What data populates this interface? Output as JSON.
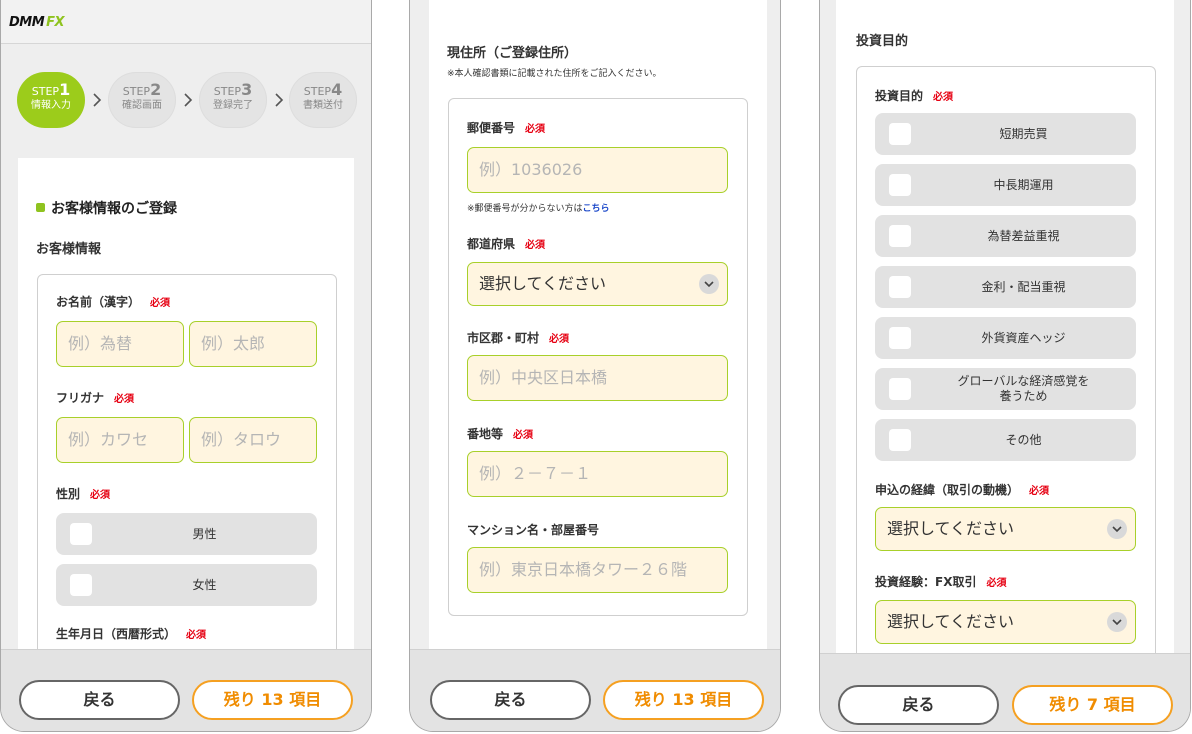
{
  "logo": {
    "dmm": "DMM",
    "fx": "FX"
  },
  "steps": [
    {
      "label": "STEP",
      "num": "1",
      "sub": "情報入力",
      "active": true
    },
    {
      "label": "STEP",
      "num": "2",
      "sub": "確認画面",
      "active": false
    },
    {
      "label": "STEP",
      "num": "3",
      "sub": "登録完了",
      "active": false
    },
    {
      "label": "STEP",
      "num": "4",
      "sub": "書類送付",
      "active": false
    }
  ],
  "screen1": {
    "section_title": "お客様情報のご登録",
    "sub_title": "お客様情報",
    "name_label": "お名前（漢字）",
    "last_name_placeholder": "例）為替",
    "first_name_placeholder": "例）太郎",
    "kana_label": "フリガナ",
    "last_kana_placeholder": "例）カワセ",
    "first_kana_placeholder": "例）タロウ",
    "gender_label": "性別",
    "gender_options": [
      "男性",
      "女性"
    ],
    "birthdate_label": "生年月日（西暦形式）"
  },
  "screen2": {
    "title": "現住所（ご登録住所）",
    "note": "※本人確認書類に記載された住所をご記入ください。",
    "postal_label": "郵便番号",
    "postal_placeholder": "例）1036026",
    "postal_note": "※郵便番号が分からない方は",
    "postal_link": "こちら",
    "pref_label": "都道府県",
    "pref_value": "選択してください",
    "city_label": "市区郡・町村",
    "city_placeholder": "例）中央区日本橋",
    "street_label": "番地等",
    "street_placeholder": "例）２－７－１",
    "building_label": "マンション名・部屋番号",
    "building_placeholder": "例）東京日本橋タワー２６階"
  },
  "screen3": {
    "section_title": "投資目的",
    "purpose_label": "投資目的",
    "purpose_options": [
      "短期売買",
      "中長期運用",
      "為替差益重視",
      "金利・配当重視",
      "外貨資産ヘッジ",
      "グローバルな経済感覚を\n養うため",
      "その他"
    ],
    "motive_label": "申込の経緯（取引の動機）",
    "motive_value": "選択してください",
    "experience_label": "投資経験：FX取引",
    "experience_value": "選択してください"
  },
  "required": "必須",
  "footer": {
    "back": "戻る",
    "remaining_1": "残り 13 項目",
    "remaining_2": "残り 13 項目",
    "remaining_3": "残り 7 項目"
  },
  "colors": {
    "accent": "#8fc31f",
    "required": "#e60012",
    "orange": "#f08c00",
    "link": "#1a47c9"
  }
}
